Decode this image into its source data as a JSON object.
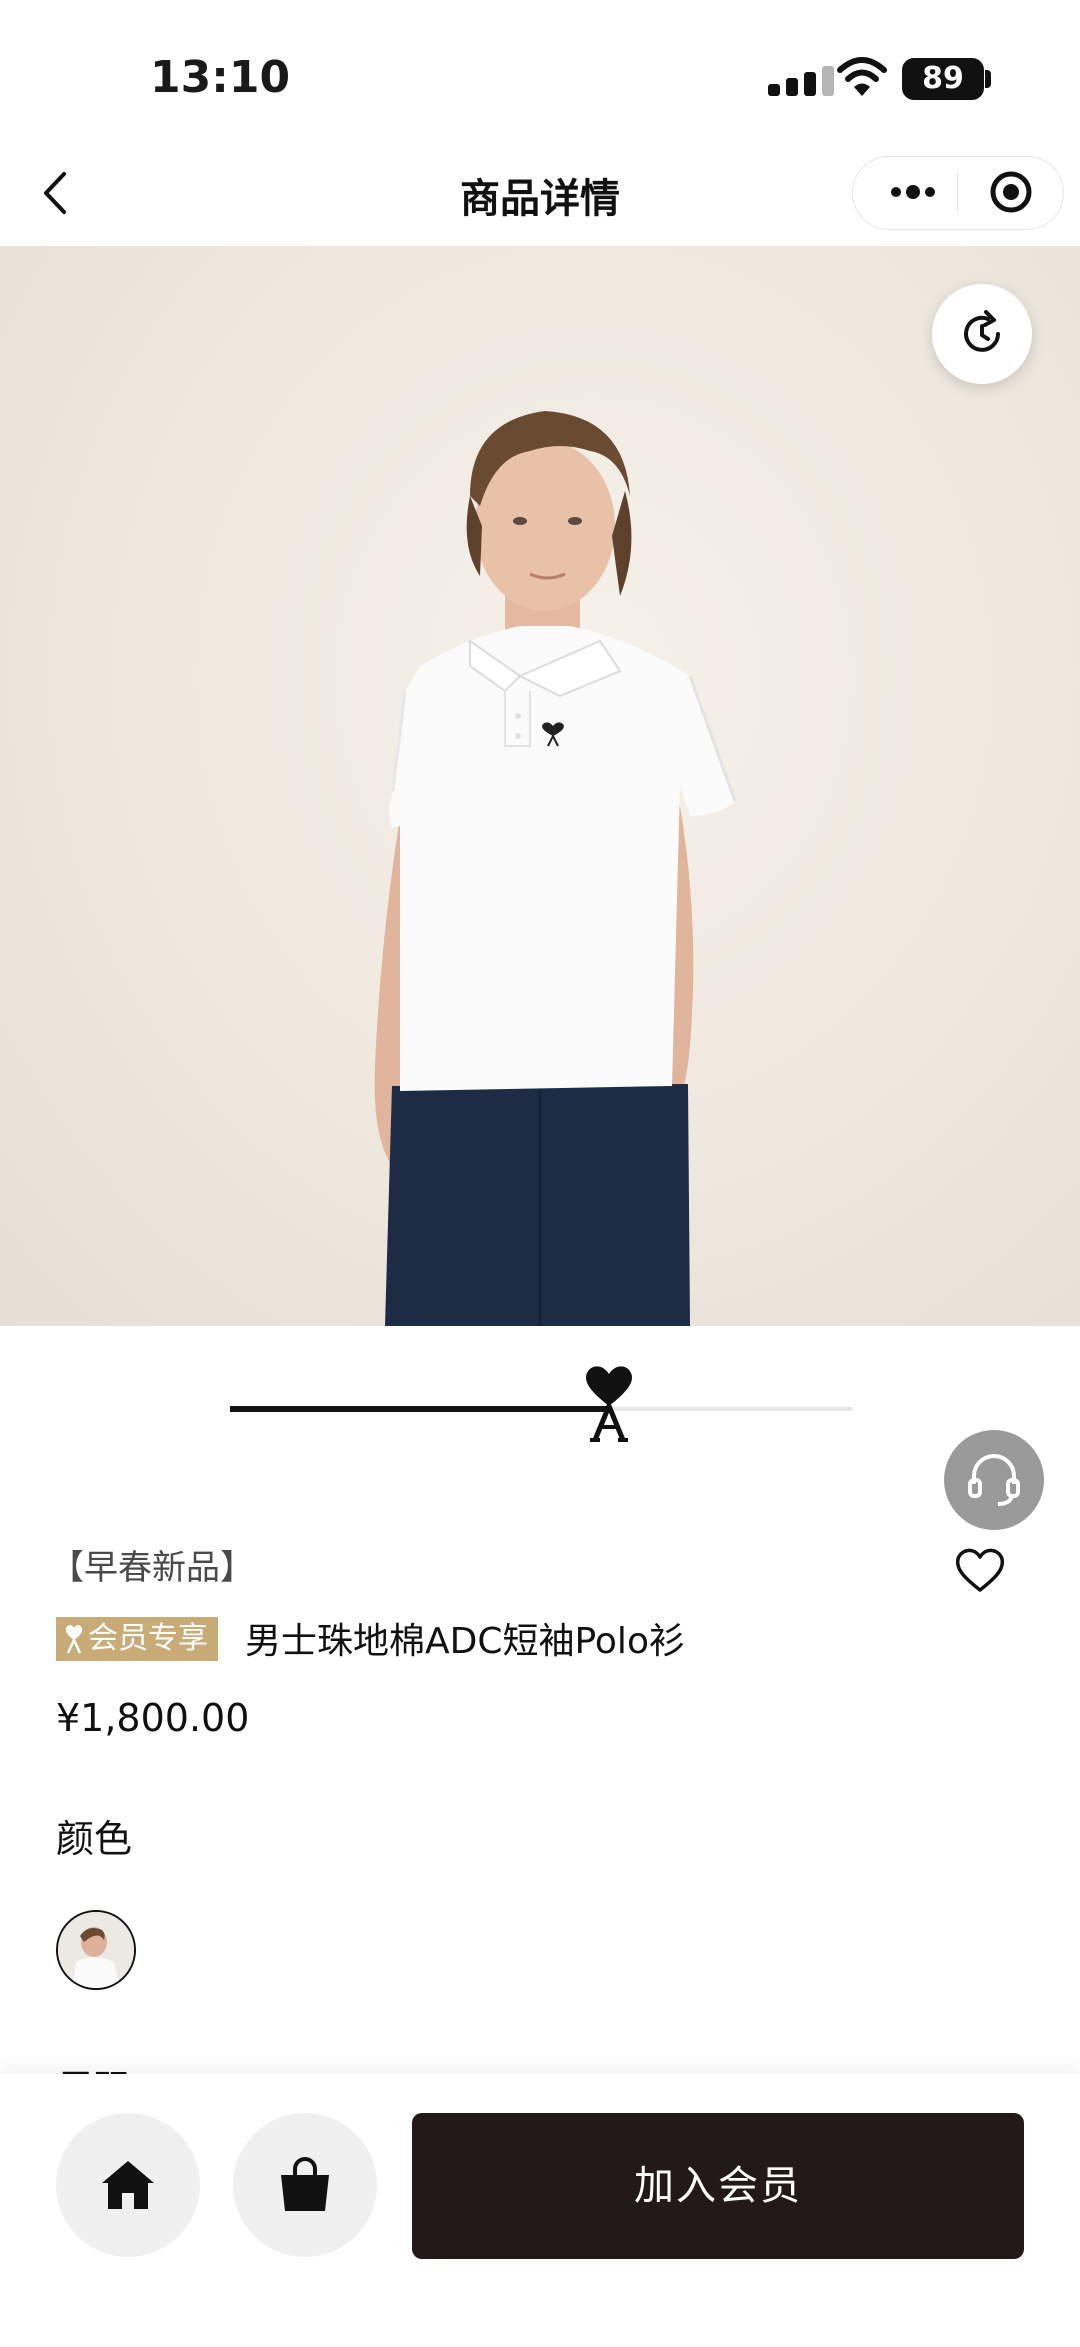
{
  "status_bar": {
    "time": "13:10",
    "battery": "89"
  },
  "nav": {
    "title": "商品详情"
  },
  "product": {
    "tag": "【早春新品】",
    "member_badge": "会员专享",
    "title": "男士珠地棉ADC短袖Polo衫",
    "price": "¥1,800.00",
    "color_label": "颜色",
    "size_label": "尺码"
  },
  "gallery": {
    "progress": 0.61
  },
  "bottom_bar": {
    "join_label": "加入会员"
  },
  "colors": {
    "badge": "#c9ab77",
    "join_button": "#231919",
    "support_button": "#9a9a9a"
  },
  "icons": [
    "back-icon",
    "more-icon",
    "close-target-icon",
    "rotate-icon",
    "customer-service-icon",
    "heart-icon",
    "home-icon",
    "shopping-bag-icon",
    "ami-heart-logo"
  ]
}
